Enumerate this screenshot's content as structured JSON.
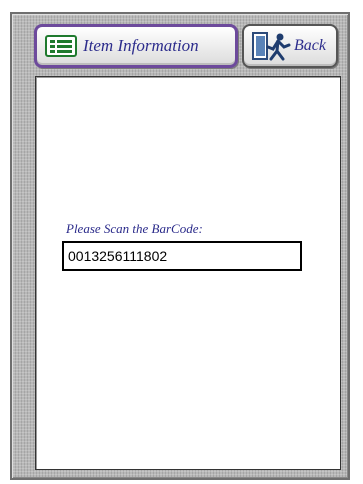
{
  "toolbar": {
    "item_info_label": "Item Information",
    "item_info_icon": "list-icon",
    "back_label": "Back",
    "back_icon": "exit-door-icon"
  },
  "main": {
    "scan_label": "Please Scan the BarCode:",
    "barcode_value": "0013256111802",
    "barcode_placeholder": ""
  },
  "colors": {
    "label_text": "#2a2a8a",
    "active_button_border": "#6d4a9c",
    "device_frame": "#b8b8b8",
    "panel_bg": "#ffffff"
  }
}
